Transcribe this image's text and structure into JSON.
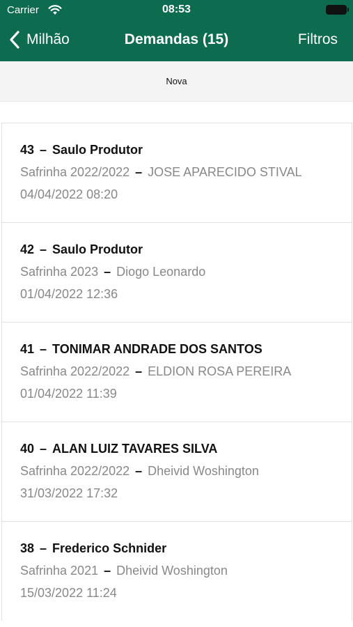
{
  "status_bar": {
    "carrier": "Carrier",
    "time": "08:53"
  },
  "nav": {
    "back_label": "Milhão",
    "title": "Demandas (15)",
    "filters_label": "Filtros"
  },
  "toolbar": {
    "new_label": "Nova"
  },
  "items": [
    {
      "id": "43",
      "name": "Saulo Produtor",
      "season": "Safrinha 2022/2022",
      "person": "JOSE APARECIDO STIVAL",
      "datetime": "04/04/2022 08:20"
    },
    {
      "id": "42",
      "name": "Saulo Produtor",
      "season": "Safrinha 2023",
      "person": "Diogo Leonardo",
      "datetime": "01/04/2022 12:36"
    },
    {
      "id": "41",
      "name": "TONIMAR ANDRADE DOS SANTOS",
      "season": "Safrinha 2022/2022",
      "person": "ELDION ROSA PEREIRA",
      "datetime": "01/04/2022 11:39"
    },
    {
      "id": "40",
      "name": "ALAN LUIZ TAVARES SILVA",
      "season": "Safrinha 2022/2022",
      "person": "Dheivid Woshington",
      "datetime": "31/03/2022 17:32"
    },
    {
      "id": "38",
      "name": "Frederico Schnider",
      "season": "Safrinha 2021",
      "person": "Dheivid Woshington",
      "datetime": "15/03/2022 11:24"
    }
  ],
  "separator": "–",
  "colors": {
    "header": "#0d6b4f",
    "secondary_text": "#888888"
  }
}
